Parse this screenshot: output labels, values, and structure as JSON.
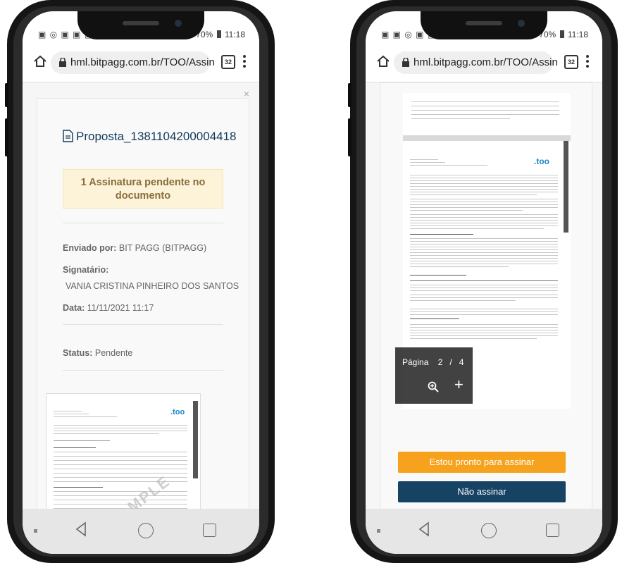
{
  "left_phone": {
    "status_bar": {
      "battery": "70%",
      "time": "11:18"
    },
    "browser": {
      "url": "hml.bitpagg.com.br/TOO/Assin",
      "tabs_count": "32"
    },
    "document": {
      "title": "Proposta_1381104200004418",
      "pending_notice": "1 Assinatura pendente no documento",
      "sent_by_label": "Enviado por:",
      "sent_by_value": "BIT PAGG (BITPAGG)",
      "signer_label": "Signatário:",
      "signer_value": "VANIA CRISTINA PINHEIRO DOS SANTOS",
      "date_label": "Data:",
      "date_value": "11/11/2021 11:17",
      "status_label": "Status:",
      "status_value": "Pendente"
    },
    "preview": {
      "logo": "too",
      "watermark": "SAMPLE"
    }
  },
  "right_phone": {
    "status_bar": {
      "battery": "70%",
      "time": "11:18"
    },
    "browser": {
      "url": "hml.bitpagg.com.br/TOO/Assin",
      "tabs_count": "32"
    },
    "viewer": {
      "page_label": "Página",
      "current_page": "2",
      "separator": "/",
      "total_pages": "4",
      "logo": "too"
    },
    "actions": {
      "sign_label": "Estou pronto para assinar",
      "no_sign_label": "Não assinar"
    }
  },
  "colors": {
    "accent_orange": "#f6a21d",
    "accent_navy": "#164263",
    "warning_bg": "#fcf3d9",
    "warning_text": "#8a6d3b",
    "title_blue": "#123a5a"
  },
  "icons": [
    "home-icon",
    "lock-icon",
    "tabs-icon",
    "menu-icon",
    "file-icon",
    "close-icon",
    "zoom-icon",
    "plus-icon",
    "back-icon",
    "circle-home-icon",
    "recent-apps-icon"
  ]
}
